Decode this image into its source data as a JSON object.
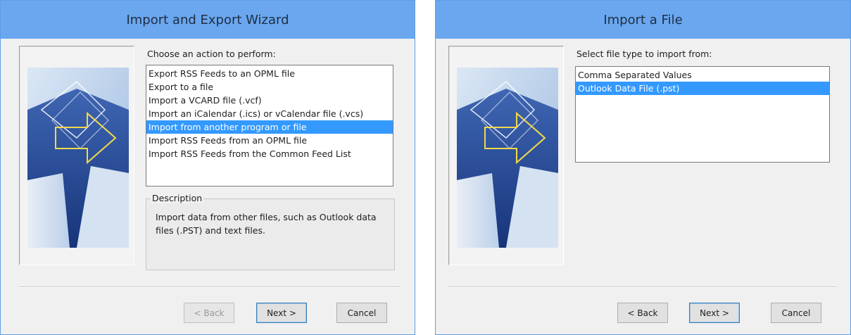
{
  "dialog1": {
    "title": "Import and Export Wizard",
    "prompt": "Choose an action to perform:",
    "items": [
      "Export RSS Feeds to an OPML file",
      "Export to a file",
      "Import a VCARD file (.vcf)",
      "Import an iCalendar (.ics) or vCalendar file (.vcs)",
      "Import from another program or file",
      "Import RSS Feeds from an OPML file",
      "Import RSS Feeds from the Common Feed List"
    ],
    "selected_item": "Import from another program or file",
    "description_label": "Description",
    "description_text": "Import data from other files, such as Outlook data files (.PST) and text files.",
    "buttons": {
      "back": "< Back",
      "back_enabled": false,
      "next": "Next >",
      "cancel": "Cancel"
    }
  },
  "dialog2": {
    "title": "Import a File",
    "prompt": "Select file type to import from:",
    "items": [
      "Comma Separated Values",
      "Outlook Data File (.pst)"
    ],
    "selected_item": "Outlook Data File (.pst)",
    "buttons": {
      "back": "< Back",
      "back_enabled": true,
      "next": "Next >",
      "cancel": "Cancel"
    }
  },
  "colors": {
    "titlebar": "#6aa7ef",
    "selection": "#3399ff",
    "art_dark": "#20418a",
    "art_light": "#cfe0f2",
    "arrow_yellow": "#f2d94a"
  }
}
